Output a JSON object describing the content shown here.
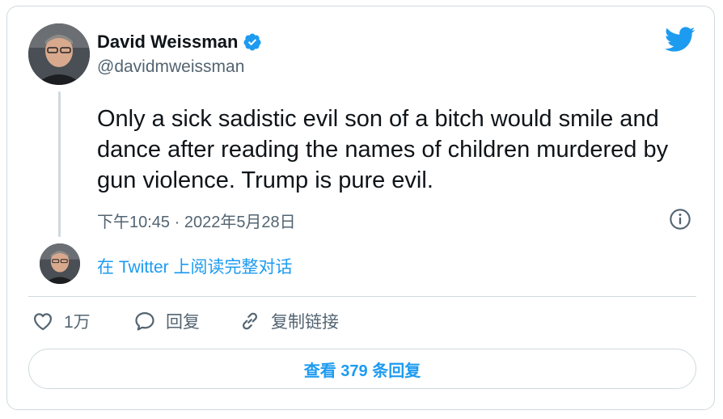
{
  "author": {
    "display_name": "David Weissman",
    "handle": "@davidmweissman",
    "verified": true
  },
  "tweet": {
    "text": "Only a sick sadistic evil son of a bitch would smile and dance after reading the names of children murdered by gun violence. Trump is pure evil.",
    "timestamp": "下午10:45 · 2022年5月28日"
  },
  "read_link": "在 Twitter 上阅读完整对话",
  "actions": {
    "like_count": "1万",
    "reply_label": "回复",
    "copy_link_label": "复制链接"
  },
  "view_replies_label": "查看 379 条回复",
  "icons": {
    "logo": "twitter-bird-icon",
    "verified": "verified-badge-icon",
    "info": "info-icon",
    "like": "heart-icon",
    "reply": "speech-bubble-icon",
    "copy": "link-icon"
  },
  "colors": {
    "accent": "#1d9bf0",
    "text": "#0f1419",
    "secondary": "#536471",
    "border": "#cfd9de"
  }
}
